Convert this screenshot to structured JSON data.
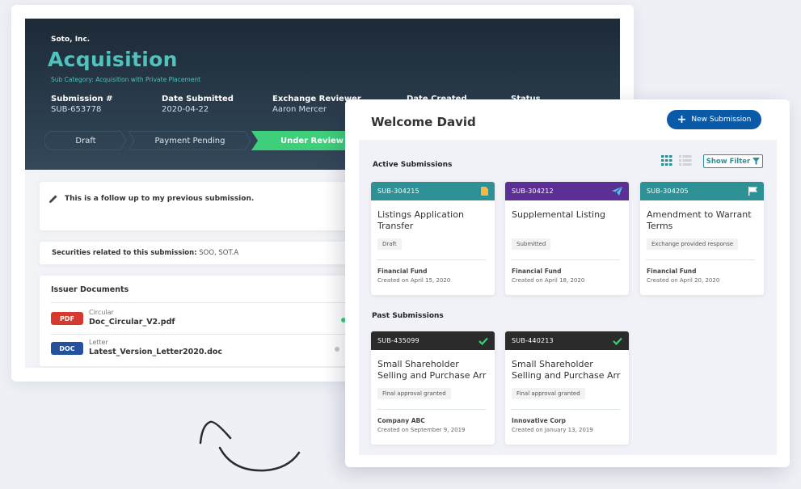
{
  "background_window": {
    "company": "Soto, Inc.",
    "title": "Acquisition",
    "sub_category": "Sub Category: Acquisition with Private Placement",
    "meta": [
      {
        "label": "Submission #",
        "value": "SUB-653778"
      },
      {
        "label": "Date Submitted",
        "value": "2020-04-22"
      },
      {
        "label": "Exchange Reviewer",
        "value": "Aaron Mercer"
      },
      {
        "label": "Date Created",
        "value": ""
      },
      {
        "label": "Status",
        "value": ""
      }
    ],
    "steps": [
      {
        "label": "Draft",
        "state": "done"
      },
      {
        "label": "Payment Pending",
        "state": "done"
      },
      {
        "label": "Under Review",
        "state": "active"
      }
    ],
    "note": "This is a follow up to my previous submission.",
    "securities_label": "Securities related to this submission:",
    "securities_value": "SOO, SOT.A",
    "documents_title": "Issuer Documents",
    "documents": [
      {
        "badge": "PDF",
        "badge_color": "#d63a2f",
        "type": "Circular",
        "name": "Doc_Circular_V2.pdf",
        "status_color": "#3ecf7a"
      },
      {
        "badge": "DOC",
        "badge_color": "#23519b",
        "type": "Letter",
        "name": "Latest_Version_Letter2020.doc",
        "status_color": "#c8c8c8"
      }
    ]
  },
  "front_window": {
    "welcome": "Welcome David",
    "new_submission_label": "New Submission",
    "active_title": "Active Submissions",
    "show_filter_label": "Show Filter",
    "past_title": "Past Submissions",
    "active_submissions": [
      {
        "id": "SUB-304215",
        "header_color": "#2e9195",
        "icon": "document-icon",
        "title": "Listings Application Transfer",
        "status": "Draft",
        "org": "Financial Fund",
        "created": "Created on April 15, 2020"
      },
      {
        "id": "SUB-304212",
        "header_color": "#5b2f93",
        "icon": "paper-plane-icon",
        "title": "Supplemental Listing",
        "status": "Submitted",
        "org": "Financial Fund",
        "created": "Created on April 18, 2020"
      },
      {
        "id": "SUB-304205",
        "header_color": "#2e9195",
        "icon": "flag-icon",
        "title": "Amendment to Warrant Terms",
        "status": "Exchange provided response",
        "org": "Financial Fund",
        "created": "Created on April 20, 2020"
      }
    ],
    "past_submissions": [
      {
        "id": "SUB-435099",
        "header_color": "#2b2b2b",
        "icon": "check-icon",
        "title": "Small Shareholder Selling and Purchase Arr",
        "status": "Final approval granted",
        "org": "Company ABC",
        "created": "Created on September 9, 2019"
      },
      {
        "id": "SUB-440213",
        "header_color": "#2b2b2b",
        "icon": "check-icon",
        "title": "Small Shareholder Selling and Purchase Arr",
        "status": "Final approval granted",
        "org": "Innovative Corp",
        "created": "Created on January 13, 2019"
      }
    ]
  },
  "colors": {
    "accent_teal": "#4fc3bd",
    "active_step": "#3ecf7a",
    "primary_blue": "#0b5aa8"
  }
}
